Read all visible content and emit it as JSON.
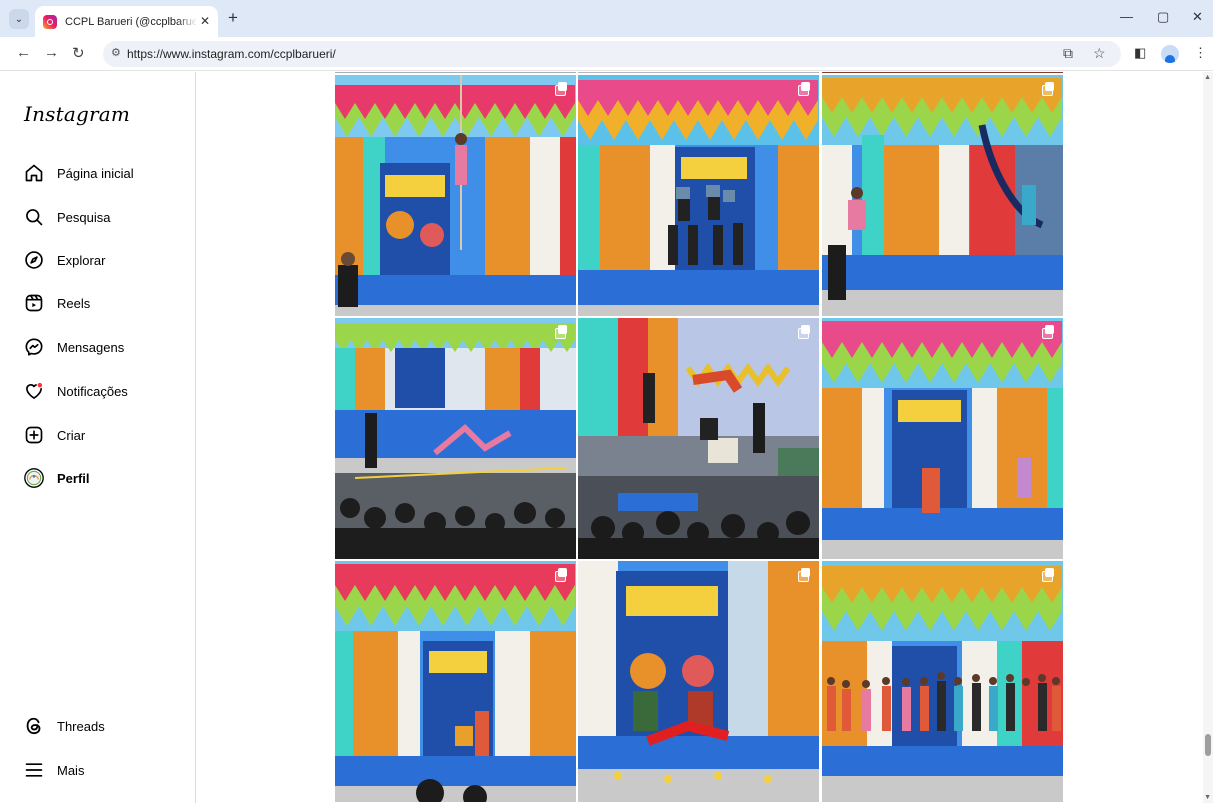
{
  "browser": {
    "tab_title": "CCPL Barueri (@ccplbarueri) • F",
    "tab_close": "✕",
    "new_tab": "+",
    "url": "https://www.instagram.com/ccplbarueri/",
    "minimize": "—",
    "maximize": "▢",
    "close": "✕"
  },
  "sidebar": {
    "logo": "Instagram",
    "items": [
      {
        "label": "Página inicial",
        "icon": "home-icon"
      },
      {
        "label": "Pesquisa",
        "icon": "search-icon"
      },
      {
        "label": "Explorar",
        "icon": "compass-icon"
      },
      {
        "label": "Reels",
        "icon": "reels-icon"
      },
      {
        "label": "Mensagens",
        "icon": "messenger-icon"
      },
      {
        "label": "Notificações",
        "icon": "heart-icon"
      },
      {
        "label": "Criar",
        "icon": "plus-square-icon"
      },
      {
        "label": "Perfil",
        "icon": "profile-avatar-icon"
      }
    ],
    "bottom_items": [
      {
        "label": "Threads",
        "icon": "threads-icon"
      },
      {
        "label": "Mais",
        "icon": "menu-icon"
      }
    ]
  },
  "posts": [
    {
      "type": "carousel",
      "scene": "aerial-ropes"
    },
    {
      "type": "carousel",
      "scene": "human-pyramid"
    },
    {
      "type": "carousel",
      "scene": "aerial-silks"
    },
    {
      "type": "carousel",
      "scene": "audience-stage"
    },
    {
      "type": "carousel",
      "scene": "trampoline-jump"
    },
    {
      "type": "carousel",
      "scene": "dancers-stage"
    },
    {
      "type": "carousel",
      "scene": "acrobatic-pair"
    },
    {
      "type": "carousel",
      "scene": "floor-contortion"
    },
    {
      "type": "carousel",
      "scene": "group-lineup"
    }
  ],
  "colors": {
    "accent": "#0095f6",
    "notification_dot": "#ff3040",
    "stage_blue": "#2b7be0",
    "curtain_orange": "#e8902a",
    "curtain_teal": "#3fd3c8",
    "curtain_red": "#e03a3a"
  }
}
